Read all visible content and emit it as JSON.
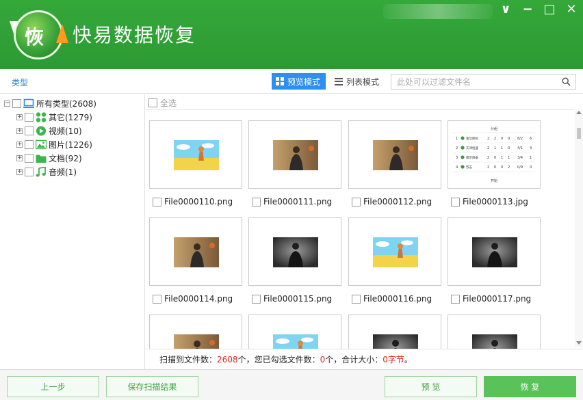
{
  "window": {
    "app_title": "快易数据恢复",
    "logo_char": "恢",
    "controls": {
      "collapse": "∨",
      "minimize": "−",
      "maximize": "□",
      "close": "✕"
    }
  },
  "toolbar": {
    "type_label": "类型",
    "preview_mode_label": "预览模式",
    "list_mode_label": "列表模式",
    "filter_placeholder": "此处可以过滤文件名"
  },
  "tree": {
    "root": {
      "label": "所有类型(2608)",
      "expander": "−"
    },
    "items": [
      {
        "label": "其它(1279)",
        "icon": "apps-icon",
        "color": "#3cb54a",
        "expander": "+"
      },
      {
        "label": "视频(10)",
        "icon": "video-play-icon",
        "color": "#3cb54a",
        "expander": "+"
      },
      {
        "label": "图片(1226)",
        "icon": "image-icon",
        "color": "#3cb54a",
        "expander": "+"
      },
      {
        "label": "文档(92)",
        "icon": "folder-icon",
        "color": "#3cb54a",
        "expander": "+"
      },
      {
        "label": "音频(1)",
        "icon": "music-note-icon",
        "color": "#3cb54a",
        "expander": "+"
      }
    ]
  },
  "content": {
    "select_all_label": "全选",
    "files": [
      {
        "name": "File0000110.png",
        "thumb": "cartoon-beach"
      },
      {
        "name": "File0000111.png",
        "thumb": "person-warm"
      },
      {
        "name": "File0000112.png",
        "thumb": "person-warm"
      },
      {
        "name": "File0000113.jpg",
        "thumb": "table-doc"
      },
      {
        "name": "File0000114.png",
        "thumb": "person-warm"
      },
      {
        "name": "File0000115.png",
        "thumb": "person-dark"
      },
      {
        "name": "File0000116.png",
        "thumb": "cartoon-beach"
      },
      {
        "name": "File0000117.png",
        "thumb": "person-dark"
      },
      {
        "name": "",
        "thumb": "person-warm"
      },
      {
        "name": "",
        "thumb": "cartoon-beach"
      },
      {
        "name": "",
        "thumb": "person-dark"
      },
      {
        "name": "",
        "thumb": "person-dark"
      }
    ],
    "thumb_table": {
      "header": "分组",
      "footer": "开始",
      "rows": [
        [
          "1",
          "金华职校",
          "2",
          "2",
          "0",
          "0",
          "8/2",
          "6"
        ],
        [
          "2",
          "天津恒盛",
          "2",
          "1",
          "1",
          "0",
          "4/1",
          "4"
        ],
        [
          "3",
          "南京阳泰",
          "2",
          "0",
          "1",
          "1",
          "3/4",
          "1"
        ],
        [
          "4",
          "苏志",
          "2",
          "0",
          "0",
          "2",
          "0/9",
          "0"
        ]
      ]
    }
  },
  "status": {
    "scanned_prefix": "扫描到文件数：",
    "scanned_count": "2608",
    "scanned_suffix": "个，您已勾选文件数：",
    "checked_count": "0",
    "checked_suffix": "个，合计大小：",
    "total_size": "0字节",
    "end": "。"
  },
  "bottom": {
    "prev_label": "上一步",
    "save_label": "保存扫描结果",
    "preview_label": "预 览",
    "recover_label": "恢 复"
  },
  "colors": {
    "header_green": "#2b9a33",
    "accent_blue": "#2d8ff0",
    "button_green": "#59c259",
    "status_red": "#e0261c"
  }
}
